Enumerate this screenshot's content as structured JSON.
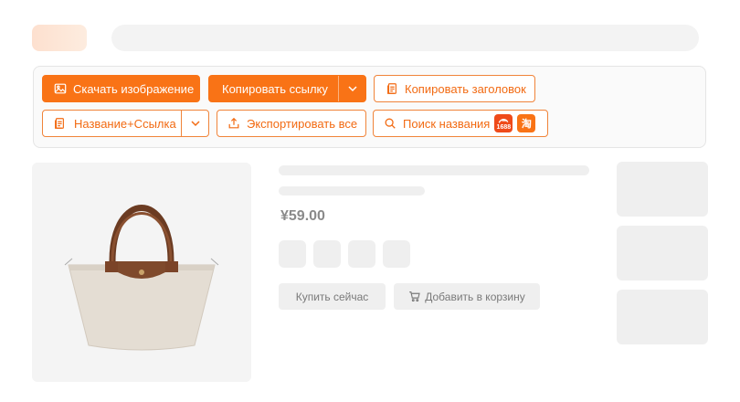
{
  "toolbar": {
    "download_image": "Скачать изображение",
    "copy_link": "Копировать ссылку",
    "copy_title": "Копировать заголовок",
    "name_link": "Название+Ссылка",
    "export_all": "Экспортировать все",
    "search_name": "Поиск названия",
    "badge_1688": "1688",
    "badge_taobao": "淘"
  },
  "product": {
    "price": "¥59.00",
    "buy_now": "Купить сейчас",
    "add_to_cart": "Добавить в корзину"
  },
  "colors": {
    "accent": "#f97316",
    "badge_1688": "#ef4a1a",
    "badge_taobao": "#f97316"
  }
}
